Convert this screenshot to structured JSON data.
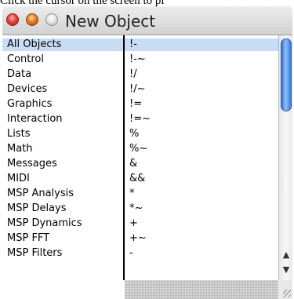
{
  "hint": "Click the cursor on the screen to pl",
  "window": {
    "title": "New Object"
  },
  "rows": [
    {
      "category": "All Objects",
      "op": "!-"
    },
    {
      "category": "Control",
      "op": "!-~"
    },
    {
      "category": "Data",
      "op": "!/"
    },
    {
      "category": "Devices",
      "op": "!/~"
    },
    {
      "category": "Graphics",
      "op": "!="
    },
    {
      "category": "Interaction",
      "op": "!=~"
    },
    {
      "category": "Lists",
      "op": "%"
    },
    {
      "category": "Math",
      "op": "%~"
    },
    {
      "category": "Messages",
      "op": "&"
    },
    {
      "category": "MIDI",
      "op": "&&"
    },
    {
      "category": "MSP Analysis",
      "op": "*"
    },
    {
      "category": "MSP Delays",
      "op": "*~"
    },
    {
      "category": "MSP Dynamics",
      "op": "+"
    },
    {
      "category": "MSP FFT",
      "op": "+~"
    },
    {
      "category": "MSP Filters",
      "op": "-"
    }
  ],
  "selected_index": 0,
  "colors": {
    "selection": "#c8dcf6",
    "scroll_thumb": "#4f8fe6"
  },
  "icons": {
    "scroll_up": "triangle-up",
    "scroll_down": "triangle-down",
    "grow": "resize-grip"
  }
}
